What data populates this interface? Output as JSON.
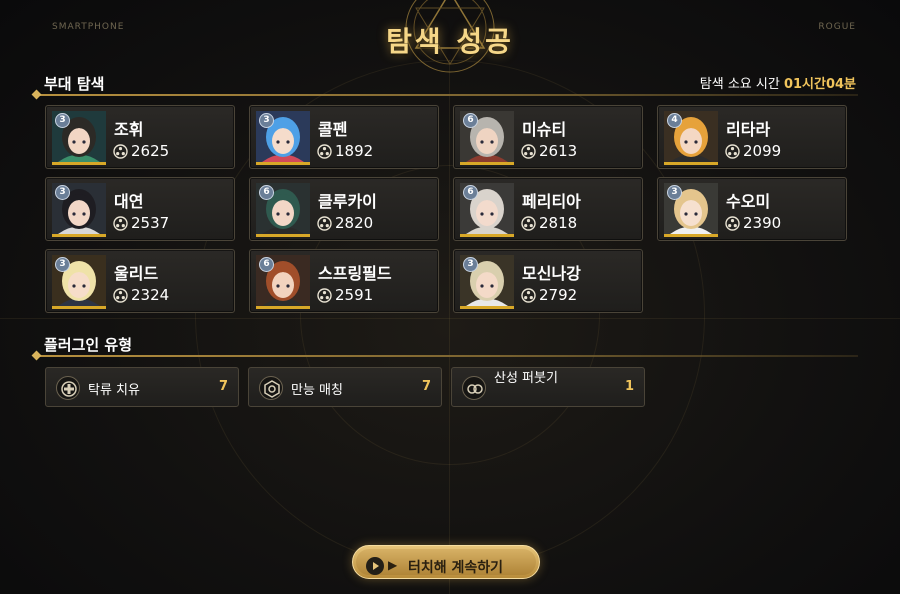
{
  "header": {
    "title": "탐색 성공",
    "left_logo": "SMARTPHONE",
    "right_logo": "ROGUE"
  },
  "squad": {
    "section_title": "부대 탐색",
    "time_label": "탐색 소요 시간",
    "time_value": "01시간04분",
    "members": [
      {
        "name": "조휘",
        "power": "2625",
        "rank": "3"
      },
      {
        "name": "콜펜",
        "power": "1892",
        "rank": "3"
      },
      {
        "name": "미슈티",
        "power": "2613",
        "rank": "6"
      },
      {
        "name": "리타라",
        "power": "2099",
        "rank": "4"
      },
      {
        "name": "대연",
        "power": "2537",
        "rank": "3"
      },
      {
        "name": "클루카이",
        "power": "2820",
        "rank": "6"
      },
      {
        "name": "페리티아",
        "power": "2818",
        "rank": "6"
      },
      {
        "name": "수오미",
        "power": "2390",
        "rank": "3"
      },
      {
        "name": "울리드",
        "power": "2324",
        "rank": "3"
      },
      {
        "name": "스프링필드",
        "power": "2591",
        "rank": "6"
      },
      {
        "name": "모신나강",
        "power": "2792",
        "rank": "3"
      }
    ]
  },
  "plugins": {
    "section_title": "플러그인 유형",
    "items": [
      {
        "name": "탁류 치유",
        "count": "7",
        "icon": "turbid-heal-icon"
      },
      {
        "name": "만능 매칭",
        "count": "7",
        "icon": "universal-match-icon"
      },
      {
        "name": "산성 퍼붓기",
        "count": "1",
        "icon": "acid-spray-icon"
      }
    ]
  },
  "continue_button": {
    "label": "터치해 계속하기"
  },
  "colors": {
    "accent_gold": "#f0c45c",
    "title_gold": "#f6d788",
    "portrait_bar": "#d8a828",
    "card_border": "#4a4438",
    "rank_badge": "#6b7f98"
  },
  "portraits": [
    {
      "hair": "#2c2a26",
      "skin": "#f2d6c4",
      "bg": "#1f3a3c",
      "accent": "#3b8f6b"
    },
    {
      "hair": "#4ea0e6",
      "skin": "#f5dccb",
      "bg": "#2b3a5a",
      "accent": "#d24a5a"
    },
    {
      "hair": "#b7b4ae",
      "skin": "#efd4c2",
      "bg": "#3a3834",
      "accent": "#8a3b2f"
    },
    {
      "hair": "#e6a23b",
      "skin": "#f4d8c4",
      "bg": "#3a2f22",
      "accent": "#2c2c2c"
    },
    {
      "hair": "#1e1d22",
      "skin": "#f2d7c7",
      "bg": "#2a2f36",
      "accent": "#d8d8d8"
    },
    {
      "hair": "#2f5a4f",
      "skin": "#f2d6c6",
      "bg": "#2a3131",
      "accent": "#2a2a2a"
    },
    {
      "hair": "#d9d3cc",
      "skin": "#f3dbcd",
      "bg": "#3b3a38",
      "accent": "#d8d4cc"
    },
    {
      "hair": "#e4c58d",
      "skin": "#f6e0cf",
      "bg": "#3a3a36",
      "accent": "#f0f0f0"
    },
    {
      "hair": "#efe2a8",
      "skin": "#f6ddc9",
      "bg": "#3a2f1e",
      "accent": "#2d3444"
    },
    {
      "hair": "#a14e2a",
      "skin": "#f2d3bf",
      "bg": "#3a2a22",
      "accent": "#2c2c2c"
    },
    {
      "hair": "#d9cfae",
      "skin": "#f4dac8",
      "bg": "#3a3427",
      "accent": "#e8e8e8"
    }
  ]
}
